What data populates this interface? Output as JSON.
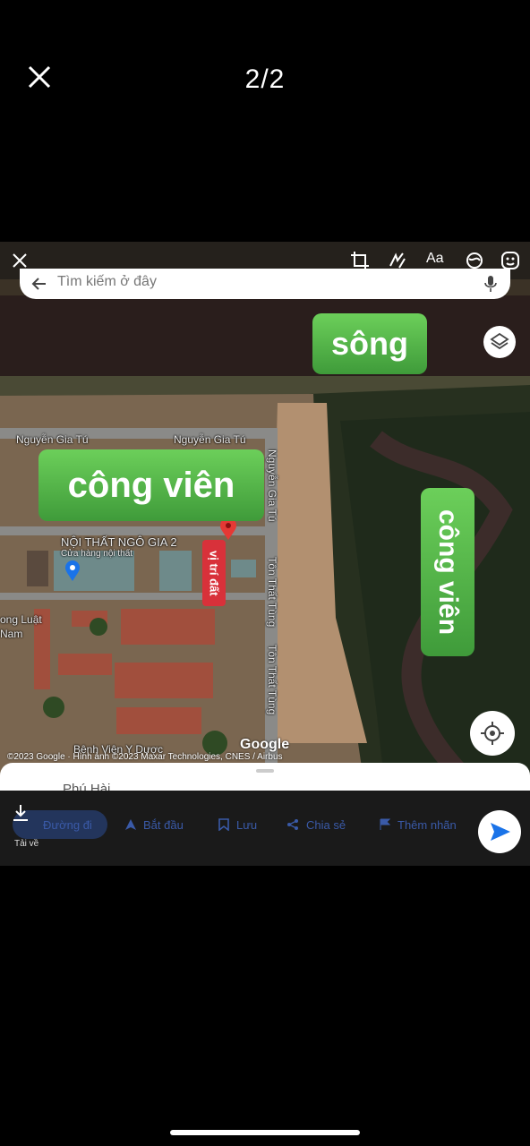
{
  "viewer": {
    "counter": "2/2"
  },
  "search": {
    "placeholder": "Tìm kiếm ở đây"
  },
  "overlays": {
    "river": "sông",
    "park_left": "công viên",
    "park_right": "công viên",
    "land_pin": "vị trí đất"
  },
  "map_labels": {
    "road_1": "Nguyễn Gia Tú",
    "road_2": "Nguyễn Gia Tú",
    "road_3": "Nguyễn Gia Tú",
    "road_4": "Tôn Thất Tùng",
    "road_5": "Tôn Thất Tùng",
    "store_name": "NỘI THẤT NGÔ GIA 2",
    "store_type": "Cửa hàng nội thất",
    "school": "ong Luật",
    "school_2": "Nam",
    "hospital": "Bệnh Viện Y Dược"
  },
  "attribution": {
    "logo": "Google",
    "copyright": "©2023 Google · Hình ảnh ©2023 Maxar Technologies, CNES / Airbus"
  },
  "sheet": {
    "place": "Phú Hài"
  },
  "actions": {
    "directions": "Đường đi",
    "start": "Bắt đầu",
    "save": "Lưu",
    "share": "Chia sẻ",
    "label": "Thêm nhãn",
    "download": "Tải về"
  },
  "icons": [
    "close-icon",
    "crop-icon",
    "draw-icon",
    "text-icon",
    "filter-icon",
    "sticker-icon",
    "back-arrow-icon",
    "mic-icon",
    "layers-icon",
    "my-location-icon",
    "map-pin-icon",
    "send-icon",
    "download-icon"
  ],
  "colors": {
    "overlay_green": "#4caf50",
    "pin_red": "#d8313a",
    "google_blue": "#1a73e8"
  }
}
